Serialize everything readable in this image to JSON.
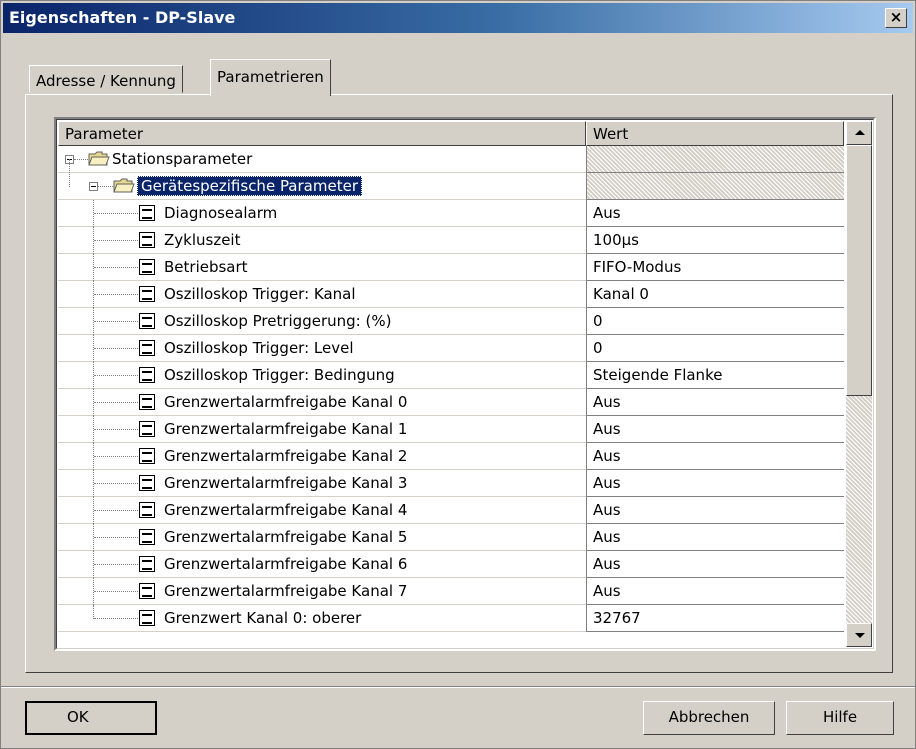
{
  "window": {
    "title": "Eigenschaften - DP-Slave",
    "close_label": "×"
  },
  "tabs": [
    {
      "label": "Adresse / Kennung",
      "active": false
    },
    {
      "label": "Parametrieren",
      "active": true
    }
  ],
  "grid": {
    "columns": [
      "Parameter",
      "Wert"
    ],
    "rows": [
      {
        "name": "Stationsparameter",
        "value": "",
        "level": 0,
        "type": "folder"
      },
      {
        "name": "Gerätespezifische Parameter",
        "value": "",
        "level": 1,
        "type": "folder",
        "selected": true
      },
      {
        "name": "Diagnosealarm",
        "value": "Aus",
        "level": 2,
        "type": "param"
      },
      {
        "name": "Zykluszeit",
        "value": "100µs",
        "level": 2,
        "type": "param"
      },
      {
        "name": "Betriebsart",
        "value": "FIFO-Modus",
        "level": 2,
        "type": "param"
      },
      {
        "name": "Oszilloskop Trigger: Kanal",
        "value": "Kanal 0",
        "level": 2,
        "type": "param"
      },
      {
        "name": "Oszilloskop Pretriggerung: (%)",
        "value": "0",
        "level": 2,
        "type": "param"
      },
      {
        "name": "Oszilloskop Trigger: Level",
        "value": "0",
        "level": 2,
        "type": "param"
      },
      {
        "name": "Oszilloskop Trigger: Bedingung",
        "value": "Steigende Flanke",
        "level": 2,
        "type": "param"
      },
      {
        "name": "Grenzwertalarmfreigabe Kanal 0",
        "value": "Aus",
        "level": 2,
        "type": "param"
      },
      {
        "name": "Grenzwertalarmfreigabe Kanal 1",
        "value": "Aus",
        "level": 2,
        "type": "param"
      },
      {
        "name": "Grenzwertalarmfreigabe Kanal 2",
        "value": "Aus",
        "level": 2,
        "type": "param"
      },
      {
        "name": "Grenzwertalarmfreigabe Kanal 3",
        "value": "Aus",
        "level": 2,
        "type": "param"
      },
      {
        "name": "Grenzwertalarmfreigabe Kanal 4",
        "value": "Aus",
        "level": 2,
        "type": "param"
      },
      {
        "name": "Grenzwertalarmfreigabe Kanal 5",
        "value": "Aus",
        "level": 2,
        "type": "param"
      },
      {
        "name": "Grenzwertalarmfreigabe Kanal 6",
        "value": "Aus",
        "level": 2,
        "type": "param"
      },
      {
        "name": "Grenzwertalarmfreigabe Kanal 7",
        "value": "Aus",
        "level": 2,
        "type": "param"
      },
      {
        "name": "Grenzwert Kanal 0: oberer",
        "value": "32767",
        "level": 2,
        "type": "param"
      }
    ]
  },
  "buttons": {
    "ok": "OK",
    "cancel": "Abbrechen",
    "help": "Hilfe"
  }
}
